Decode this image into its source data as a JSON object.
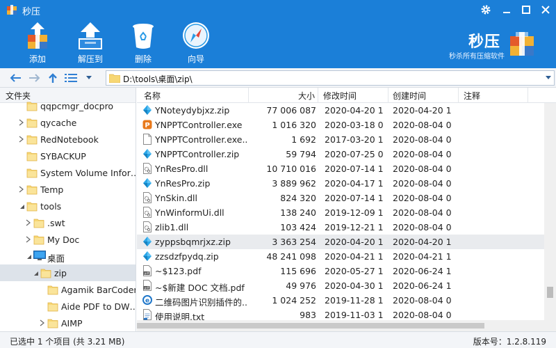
{
  "app": {
    "title": "秒压"
  },
  "toolbar": {
    "add_label": "添加",
    "extract_label": "解压到",
    "delete_label": "删除",
    "wizard_label": "向导"
  },
  "brand": {
    "name": "秒压",
    "slogan": "秒杀所有压缩软件"
  },
  "address": {
    "path": "D:\\tools\\桌面\\zip\\"
  },
  "tree": {
    "header": "文件夹",
    "items": [
      {
        "label": "qqpcmgr_docpro",
        "arrow": "",
        "level": 1
      },
      {
        "label": "qycache",
        "arrow": "right",
        "level": 1
      },
      {
        "label": "RedNotebook",
        "arrow": "right",
        "level": 1
      },
      {
        "label": "SYBACKUP",
        "arrow": "",
        "level": 1
      },
      {
        "label": "System Volume Infor…",
        "arrow": "",
        "level": 1
      },
      {
        "label": "Temp",
        "arrow": "right",
        "level": 1
      },
      {
        "label": "tools",
        "arrow": "down",
        "level": 1
      },
      {
        "label": ".swt",
        "arrow": "right",
        "level": 2
      },
      {
        "label": "My Doc",
        "arrow": "right",
        "level": 2
      },
      {
        "label": "桌面",
        "arrow": "down",
        "level": 2,
        "desktop": true
      },
      {
        "label": "zip",
        "arrow": "down",
        "level": 3,
        "selected": true
      },
      {
        "label": "Agamik BarCoder",
        "arrow": "",
        "level": 4
      },
      {
        "label": "Aide PDF to DW…",
        "arrow": "",
        "level": 4
      },
      {
        "label": "AIMP",
        "arrow": "right",
        "level": 4
      }
    ]
  },
  "columns": {
    "name": "名称",
    "size": "大小",
    "modified": "修改时间",
    "created": "创建时间",
    "comment": "注释"
  },
  "files": [
    {
      "name": "YNoteydybjxz.zip",
      "size": "77 006 087",
      "modified": "2020-04-20 1",
      "created": "2020-04-20 1",
      "icon": "zip"
    },
    {
      "name": "YNPPTController.exe",
      "size": "1 016 320",
      "modified": "2020-03-18 0",
      "created": "2020-08-04 0",
      "icon": "exe"
    },
    {
      "name": "YNPPTController.exe....",
      "size": "1 692",
      "modified": "2017-03-20 1",
      "created": "2020-08-04 0",
      "icon": "doc"
    },
    {
      "name": "YNPPTController.zip",
      "size": "59 794",
      "modified": "2020-07-25 0",
      "created": "2020-08-04 0",
      "icon": "zip"
    },
    {
      "name": "YnResPro.dll",
      "size": "10 710 016",
      "modified": "2020-07-14 1",
      "created": "2020-08-04 0",
      "icon": "dll"
    },
    {
      "name": "YnResPro.zip",
      "size": "3 889 962",
      "modified": "2020-04-17 1",
      "created": "2020-08-04 0",
      "icon": "zip"
    },
    {
      "name": "YnSkin.dll",
      "size": "824 320",
      "modified": "2020-07-14 1",
      "created": "2020-08-04 0",
      "icon": "dll"
    },
    {
      "name": "YnWinformUi.dll",
      "size": "138 240",
      "modified": "2019-12-09 1",
      "created": "2020-08-04 0",
      "icon": "dll"
    },
    {
      "name": "zlib1.dll",
      "size": "103 424",
      "modified": "2019-12-21 1",
      "created": "2020-08-04 0",
      "icon": "dll"
    },
    {
      "name": "zyppsbqmrjxz.zip",
      "size": "3 363 254",
      "modified": "2020-04-20 1",
      "created": "2020-04-20 1",
      "icon": "zip",
      "highlight": true
    },
    {
      "name": "zzsdzfpydq.zip",
      "size": "48 241 098",
      "modified": "2020-04-21 1",
      "created": "2020-04-21 1",
      "icon": "zip"
    },
    {
      "name": "~$123.pdf",
      "size": "115 696",
      "modified": "2020-05-27 1",
      "created": "2020-06-24 1",
      "icon": "pdf"
    },
    {
      "name": "~$新建 DOC 文档.pdf",
      "size": "49 976",
      "modified": "2020-04-30 1",
      "created": "2020-06-24 1",
      "icon": "pdf"
    },
    {
      "name": "二维码图片识别插件的...",
      "size": "1 024 252",
      "modified": "2019-11-28 1",
      "created": "2020-08-04 0",
      "icon": "ie"
    },
    {
      "name": "使用说明.txt",
      "size": "983",
      "modified": "2019-11-03 1",
      "created": "2020-08-04 0",
      "icon": "txt"
    }
  ],
  "status": {
    "selection": "已选中 1 个项目 (共 3.21 MB)",
    "version": "版本号：1.2.8.119"
  },
  "colors": {
    "header_blue": "#1b7fd8",
    "folder_yellow": "#f7d774",
    "zip_blue": "#2aa6e8",
    "exe_orange": "#e8791b"
  }
}
